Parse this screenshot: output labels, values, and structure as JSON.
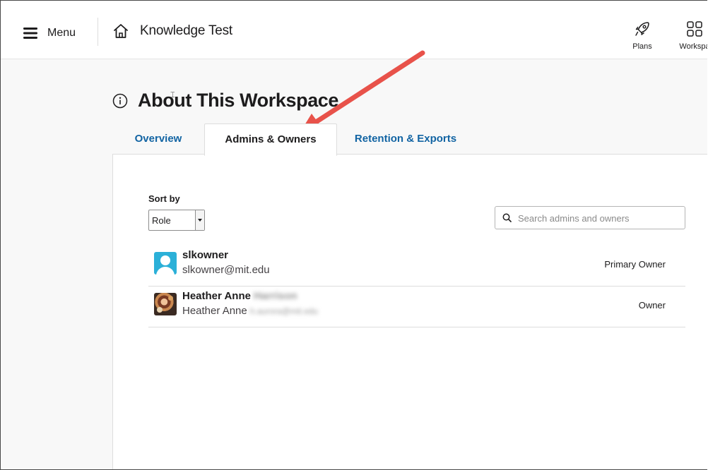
{
  "topbar": {
    "menu_label": "Menu",
    "workspace_name": "Knowledge Test",
    "plans_label": "Plans",
    "workspace_label": "Workspa"
  },
  "page": {
    "heading": "About This Workspace"
  },
  "tabs": [
    {
      "label": "Overview",
      "active": false
    },
    {
      "label": "Admins & Owners",
      "active": true
    },
    {
      "label": "Retention & Exports",
      "active": false
    }
  ],
  "sort": {
    "label": "Sort by",
    "value": "Role"
  },
  "search": {
    "placeholder": "Search admins and owners",
    "value": ""
  },
  "users": [
    {
      "name": "slkowner",
      "name_hidden": "",
      "email": "slkowner@mit.edu",
      "email_hidden": "",
      "role": "Primary Owner",
      "avatar": "default-user-avatar"
    },
    {
      "name": "Heather Anne",
      "name_hidden": "Harrison",
      "email": "Heather Anne",
      "email_hidden": "h.aurora@mit.edu",
      "role": "Owner",
      "avatar": "photo-avatar"
    }
  ],
  "colors": {
    "link": "#1264a3",
    "annotation_arrow": "#e8524a",
    "avatar_default": "#2bb0d8"
  },
  "icons": [
    "hamburger-icon",
    "home-icon",
    "rocket-icon",
    "grid-icon",
    "info-icon",
    "search-icon",
    "dropdown-arrow-icon",
    "annotation-arrow"
  ]
}
